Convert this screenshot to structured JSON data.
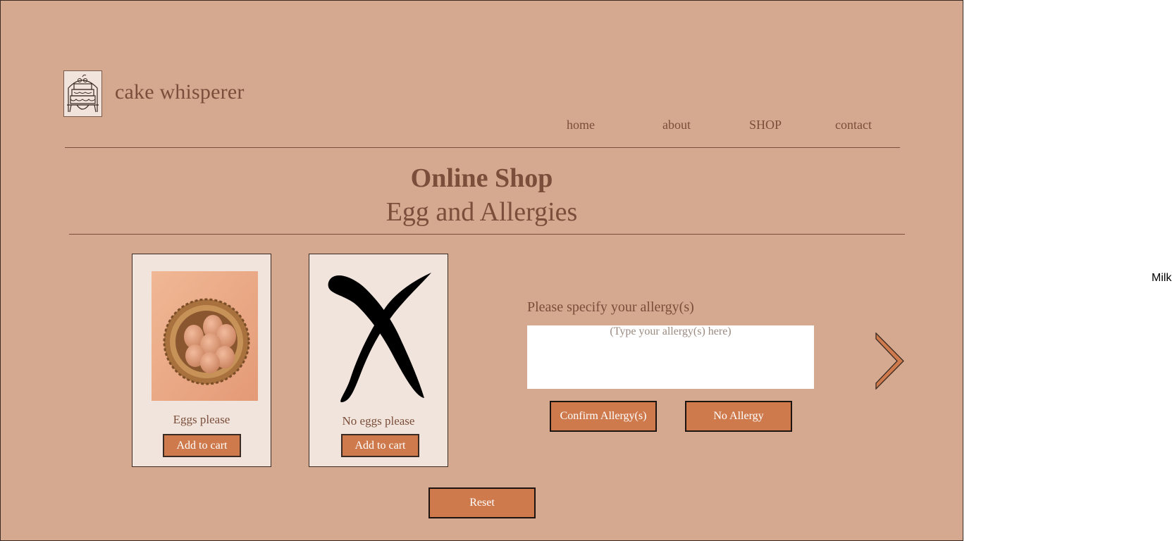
{
  "brand": {
    "name": "cake whisperer",
    "logo_icon": "cake-logo-icon"
  },
  "nav": {
    "home": "home",
    "about": "about",
    "shop": "SHOP",
    "contact": "contact"
  },
  "page": {
    "title": "Online Shop",
    "subtitle": "Egg and Allergies"
  },
  "products": [
    {
      "label": "Eggs please",
      "button": "Add to cart",
      "image_icon": "egg-basket-image"
    },
    {
      "label": "No eggs please",
      "button": "Add to cart",
      "image_icon": "cross-mark-icon"
    }
  ],
  "allergy": {
    "label": "Please specify your allergy(s)",
    "placeholder": "(Type your allergy(s) here)",
    "value": "",
    "confirm_label": "Confirm Allergy(s)",
    "no_allergy_label": "No Allergy"
  },
  "reset_label": "Reset",
  "next_icon": "chevron-right-icon",
  "offscreen_label": "Milk",
  "colors": {
    "background": "#d5a890",
    "card": "#f1e4dc",
    "accent": "#cf7a4c",
    "text": "#7a4e3a"
  }
}
